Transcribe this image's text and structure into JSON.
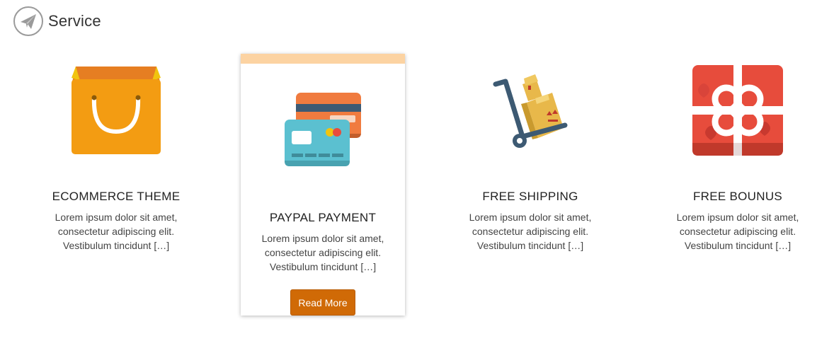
{
  "header": {
    "title": "Service",
    "icon": "paper-plane-icon"
  },
  "services": [
    {
      "title": "ECOMMERCE THEME",
      "description": "Lorem ipsum dolor sit amet, consectetur adipiscing elit. Vestibulum tincidunt […]",
      "icon": "shopping-bag-icon"
    },
    {
      "title": "PAYPAL PAYMENT",
      "description": "Lorem ipsum dolor sit amet, consectetur adipiscing elit. Vestibulum tincidunt […]",
      "icon": "credit-cards-icon",
      "button_label": "Read More",
      "highlighted": true
    },
    {
      "title": "FREE SHIPPING",
      "description": "Lorem ipsum dolor sit amet, consectetur adipiscing elit. Vestibulum tincidunt […]",
      "icon": "hand-truck-icon"
    },
    {
      "title": "FREE BOUNUS",
      "description": "Lorem ipsum dolor sit amet, consectetur adipiscing elit. Vestibulum tincidunt […]",
      "icon": "gift-box-icon"
    }
  ],
  "colors": {
    "accent_button": "#d06a06",
    "card_top_border": "#fcd3a2",
    "bag_orange": "#f39c12",
    "gift_red": "#e74c3c",
    "card_blue": "#5bc0d0",
    "card_orange": "#f07b3f"
  }
}
